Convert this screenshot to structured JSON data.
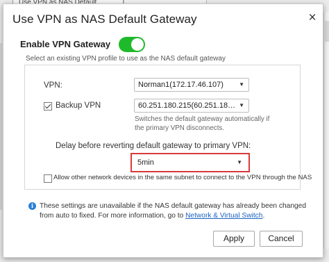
{
  "background": {
    "tab_text": "Use VPN as NAS Default Gateway"
  },
  "dialog": {
    "title": "Use VPN as NAS Default Gateway",
    "close_glyph": "×",
    "enable_label": "Enable VPN Gateway",
    "enable_toggle_on": true,
    "description": "Select an existing VPN profile to use as the NAS default gateway",
    "vpn_label": "VPN:",
    "vpn_value": "Norman1(172.17.46.107)",
    "backup_label": "Backup VPN",
    "backup_checked": true,
    "backup_value": "60.251.180.215(60.251.180....",
    "backup_helper": "Switches the default gateway automatically if the primary VPN disconnects.",
    "delay_label": "Delay before reverting default gateway to primary VPN:",
    "delay_value": "5min",
    "allow_label": "Allow other network devices in the same subnet to connect to the VPN through the NAS",
    "allow_checked": false,
    "info_text": "These settings are unavailable if the NAS default gateway has already been changed from auto to fixed. For more information, go to ",
    "info_link": "Network & Virtual Switch",
    "info_suffix": ".",
    "apply_label": "Apply",
    "cancel_label": "Cancel"
  },
  "colors": {
    "toggle_on": "#1fba2b",
    "highlight": "#d83a3a",
    "link": "#1d62c4",
    "info_icon": "#2c7fd6"
  },
  "icons": {
    "dropdown": "chevron-down-icon",
    "info": "info-icon",
    "close": "close-icon"
  }
}
